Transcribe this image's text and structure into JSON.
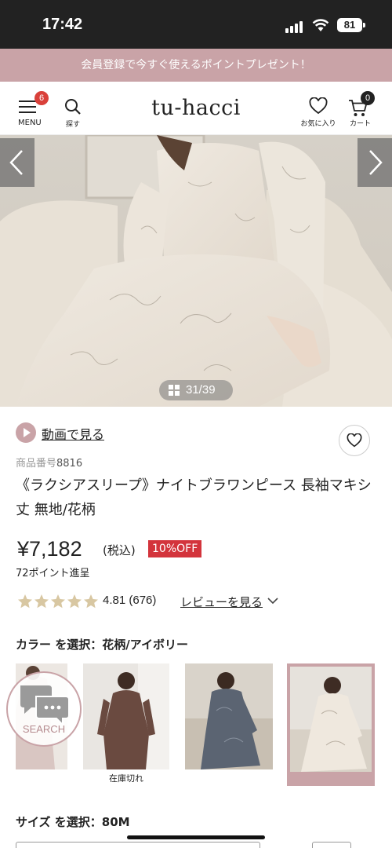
{
  "status_bar": {
    "time": "17:42",
    "battery": "81"
  },
  "promo_banner": {
    "text": "会員登録で今すぐ使えるポイントプレゼント！"
  },
  "header": {
    "menu_label": "MENU",
    "menu_badge": "6",
    "search_label": "探す",
    "logo": "tu-hacci",
    "favorites_label": "お気に入り",
    "cart_label": "カート",
    "cart_badge": "0"
  },
  "gallery": {
    "counter": "31/39",
    "current": 31,
    "total": 39
  },
  "product": {
    "video_link": "動画で見る",
    "item_number_label": "商品番号",
    "item_number": "8816",
    "title": "《ラクシアスリープ》ナイトブラワンピース 長袖マキシ丈 無地/花柄",
    "price": "¥7,182",
    "tax_label": "(税込)",
    "discount_badge": "10%OFF",
    "points": "72ポイント進呈",
    "rating_value": "4.81",
    "rating_count": "(676)",
    "stars": 5,
    "review_link": "レビューを見る"
  },
  "color_selector": {
    "label": "カラー を選択：花柄/アイボリー",
    "options": [
      {
        "state": "available"
      },
      {
        "state": "soldout",
        "status_label": "在庫切れ"
      },
      {
        "state": "available"
      },
      {
        "state": "selected"
      }
    ]
  },
  "floating_search": {
    "label": "SEARCH"
  },
  "size_selector": {
    "label": "サイズ を選択：80M"
  },
  "colors": {
    "accent_pink": "#c9a3a7",
    "sale_red": "#d3343c",
    "star_gold": "#d8c7a2"
  }
}
